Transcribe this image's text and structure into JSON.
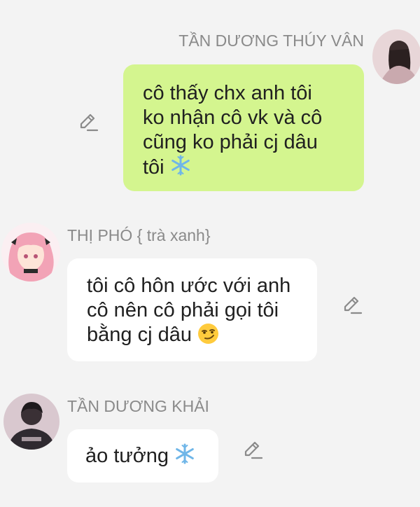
{
  "messages": [
    {
      "sender": "TẦN DƯƠNG THÚY VÂN",
      "lines": [
        " cô thấy chx anh tôi",
        "ko nhận cô vk và cô",
        "cũng ko phải cj dâu",
        "tôi "
      ],
      "emoji": "snowflake-emoji",
      "side": "right"
    },
    {
      "sender": "THỊ  PHÓ { trà xanh}",
      "lines": [
        " tôi cô hôn ước với anh",
        "cô nên cô phải gọi tôi",
        "bằng cj dâu "
      ],
      "emoji": "smirk-emoji",
      "side": "left"
    },
    {
      "sender": "TẦN DƯƠNG KHẢI",
      "lines": [
        "ảo tưởng "
      ],
      "emoji": "snowflake-emoji",
      "side": "left"
    }
  ],
  "colors": {
    "background": "#f3f3f3",
    "outgoing_bubble": "#d4f58f",
    "incoming_bubble": "#ffffff",
    "name_text": "#8a8a8a",
    "message_text": "#202020"
  },
  "icons": [
    "edit-pencil-icon",
    "avatar"
  ]
}
